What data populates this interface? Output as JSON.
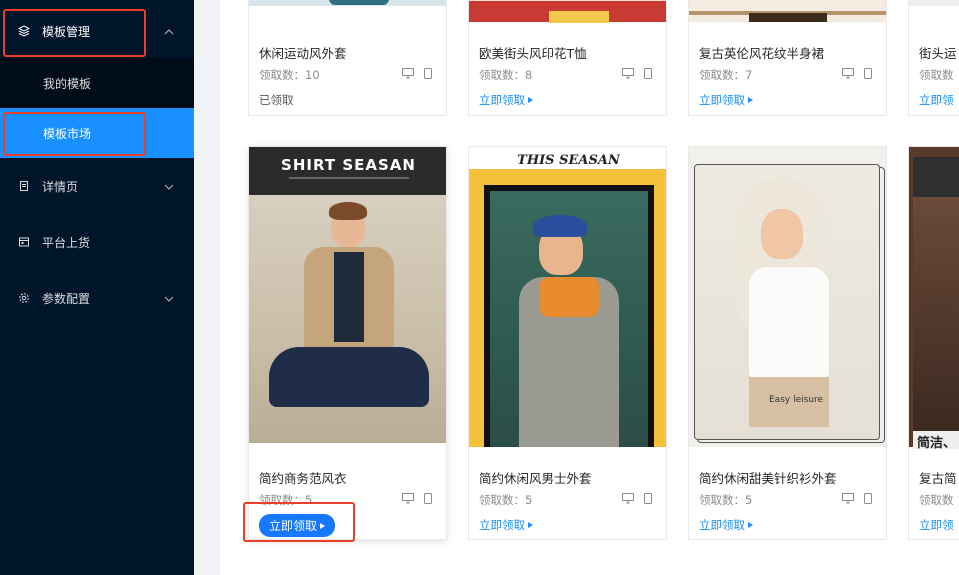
{
  "sidebar": {
    "template_mgmt": "模板管理",
    "my_templates": "我的模板",
    "template_market": "模板市场",
    "details_page": "详情页",
    "platform_listing": "平台上货",
    "param_config": "参数配置"
  },
  "cards_top": [
    {
      "title": "休闲运动风外套",
      "count_label": "领取数：10",
      "action": "已领取"
    },
    {
      "title": "欧美街头风印花T恤",
      "count_label": "领取数：8",
      "action": "立即领取"
    },
    {
      "title": "复古英伦风花纹半身裙",
      "count_label": "领取数：7",
      "action": "立即领取"
    },
    {
      "title": "街头运",
      "count_label": "领取数",
      "action": "立即领"
    }
  ],
  "cards_bottom": [
    {
      "title": "简约商务范风衣",
      "count_label": "领取数：5",
      "action": "立即领取",
      "thumb_text": "SHIRT SEASAN"
    },
    {
      "title": "简约休闲风男士外套",
      "count_label": "领取数：5",
      "action": "立即领取",
      "thumb_text": "THIS SEASAN"
    },
    {
      "title": "简约休闲甜美针织衫外套",
      "count_label": "领取数：5",
      "action": "立即领取",
      "thumb_text": "Easy leisure"
    },
    {
      "title": "复古简",
      "count_label": "领取数",
      "action": "立即领",
      "thumb_text": "简洁、"
    }
  ],
  "colors": {
    "sidebar_bg": "#001529",
    "active": "#1890ff",
    "highlight": "#e8402a"
  }
}
